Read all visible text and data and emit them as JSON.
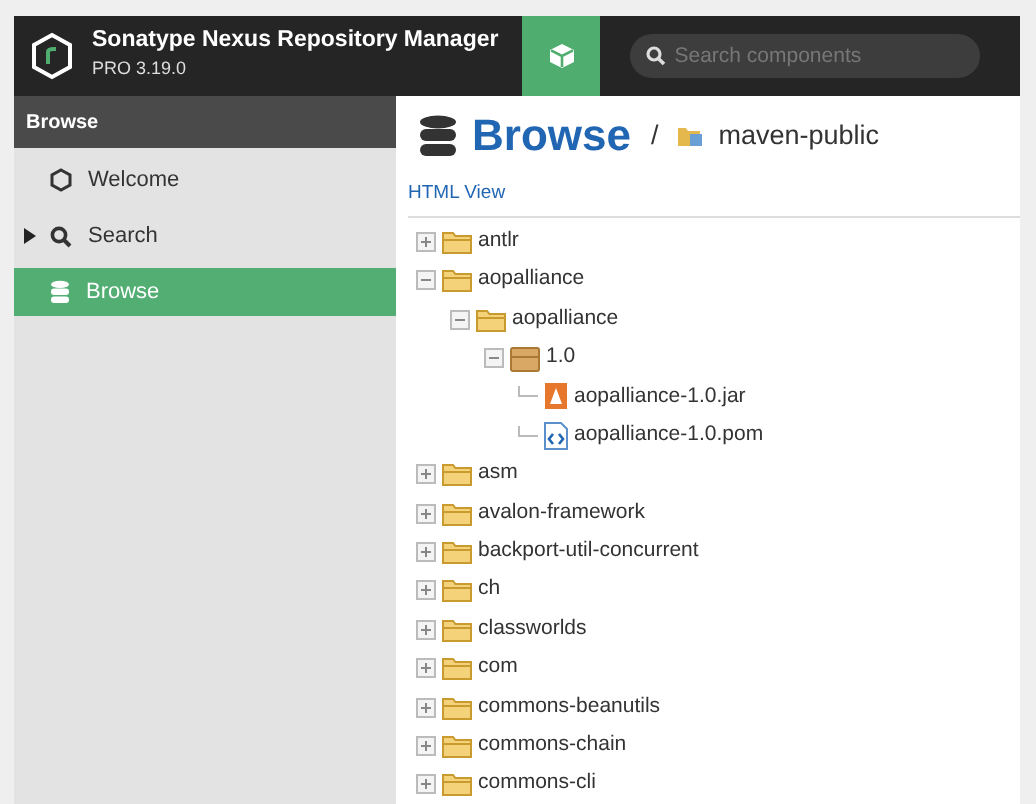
{
  "header": {
    "product": "Sonatype Nexus Repository Manager",
    "edition": "PRO 3.19.0",
    "search": {
      "placeholder": "Search components"
    }
  },
  "sidebar": {
    "title": "Browse",
    "items": [
      {
        "label": "Welcome",
        "kind": "welcome",
        "selected": false
      },
      {
        "label": "Search",
        "kind": "search",
        "selected": false,
        "expanded": false
      },
      {
        "label": "Browse",
        "kind": "browse",
        "selected": true
      }
    ]
  },
  "content": {
    "title": "Browse",
    "separator": "/",
    "repository": "maven-public",
    "html_view": "HTML View",
    "tree": [
      {
        "label": "antlr",
        "kind": "folder",
        "expanded": false
      },
      {
        "label": "aopalliance",
        "kind": "folder",
        "expanded": true,
        "children": [
          {
            "label": "aopalliance",
            "kind": "folder",
            "expanded": true,
            "children": [
              {
                "label": "1.0",
                "kind": "package",
                "expanded": true,
                "children": [
                  {
                    "label": "aopalliance-1.0.jar",
                    "kind": "jar"
                  },
                  {
                    "label": "aopalliance-1.0.pom",
                    "kind": "pom"
                  }
                ]
              }
            ]
          }
        ]
      },
      {
        "label": "asm",
        "kind": "folder",
        "expanded": false
      },
      {
        "label": "avalon-framework",
        "kind": "folder",
        "expanded": false
      },
      {
        "label": "backport-util-concurrent",
        "kind": "folder",
        "expanded": false
      },
      {
        "label": "ch",
        "kind": "folder",
        "expanded": false
      },
      {
        "label": "classworlds",
        "kind": "folder",
        "expanded": false
      },
      {
        "label": "com",
        "kind": "folder",
        "expanded": false
      },
      {
        "label": "commons-beanutils",
        "kind": "folder",
        "expanded": false
      },
      {
        "label": "commons-chain",
        "kind": "folder",
        "expanded": false
      },
      {
        "label": "commons-cli",
        "kind": "folder",
        "expanded": false
      }
    ]
  }
}
